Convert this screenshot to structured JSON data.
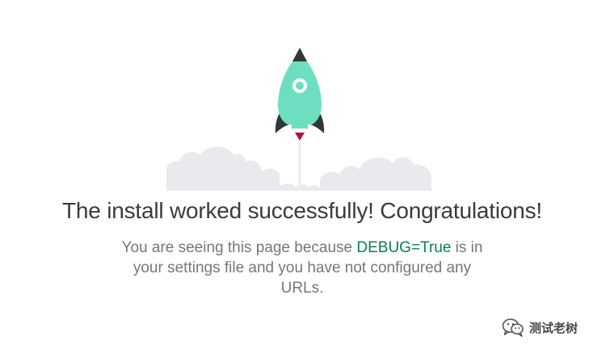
{
  "main": {
    "headline": "The install worked successfully! Congratulations!",
    "description": {
      "before": "You are seeing this page because ",
      "flag": "DEBUG=True",
      "after": " is in your settings file and you have not configured any URLs."
    }
  },
  "watermark": {
    "text": "测试老树",
    "icon": "wechat-icon"
  },
  "colors": {
    "rocket_body": "#6ddfc0",
    "rocket_fins": "#2f3a37",
    "rocket_flame": "#a9163f",
    "cloud": "#e9eaed",
    "headline": "#3b3b3b",
    "body_text": "#777777",
    "debug_flag": "#0c7c59"
  }
}
